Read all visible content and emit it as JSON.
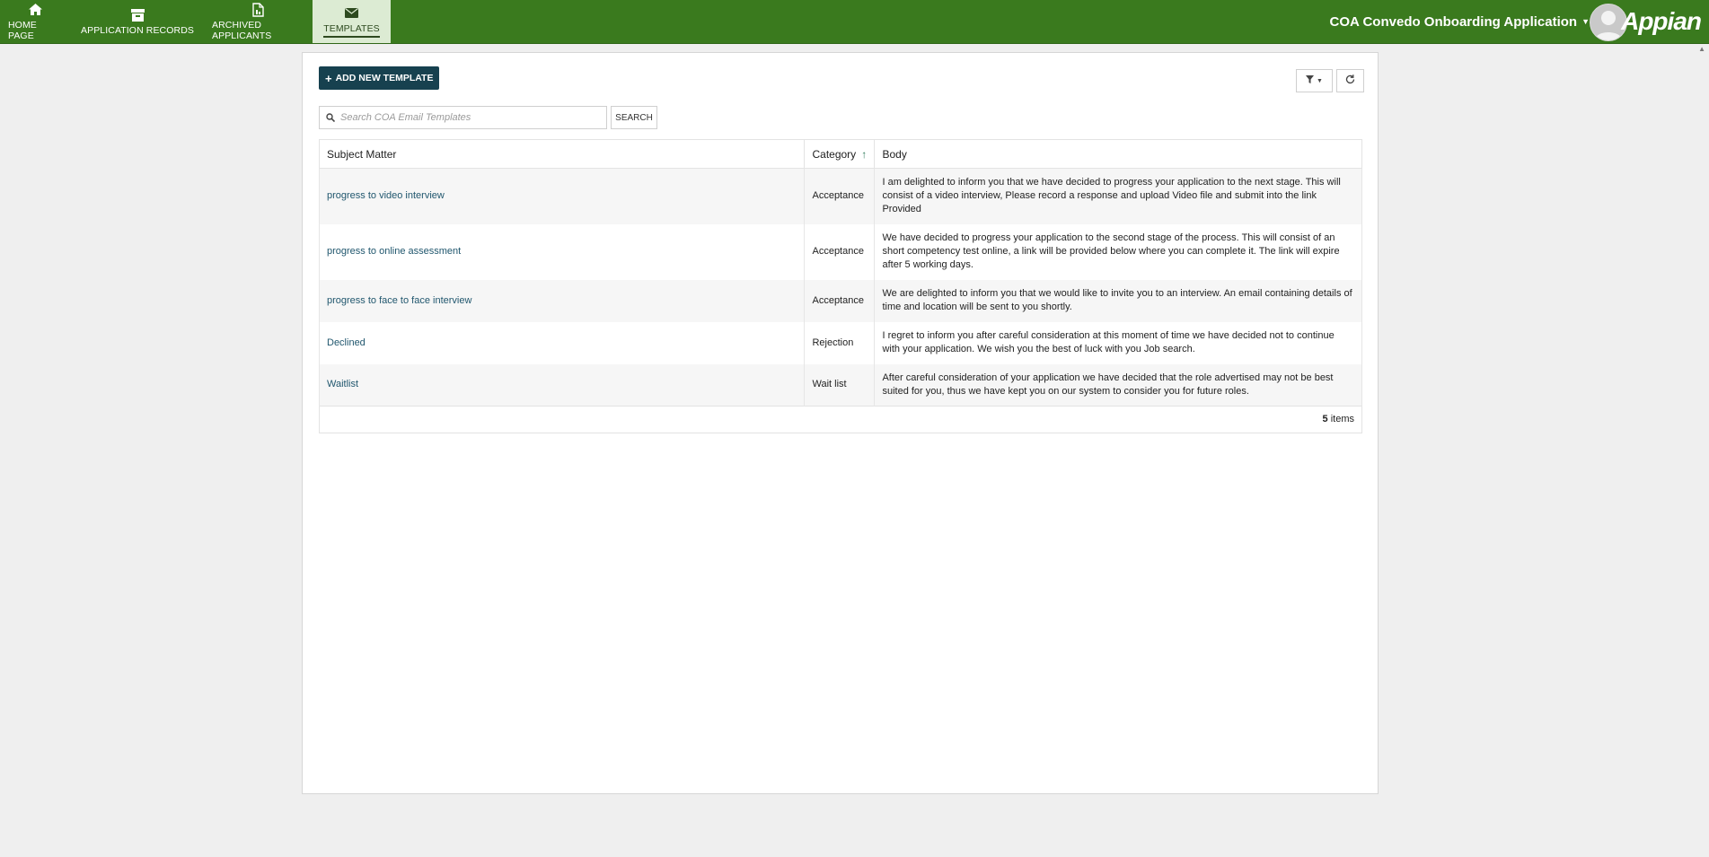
{
  "nav": {
    "items": [
      {
        "label": "HOME PAGE",
        "icon": "home-icon"
      },
      {
        "label": "APPLICATION RECORDS",
        "icon": "archive-box-icon"
      },
      {
        "label": "ARCHIVED APPLICANTS",
        "icon": "document-icon"
      },
      {
        "label": "TEMPLATES",
        "icon": "envelope-icon",
        "active": true
      }
    ]
  },
  "header": {
    "app_name": "COA Convedo Onboarding Application",
    "logo_text": "Appian"
  },
  "toolbar": {
    "add_label": "ADD NEW TEMPLATE",
    "search_placeholder": "Search COA Email Templates",
    "search_button": "SEARCH"
  },
  "grid": {
    "columns": [
      "Subject Matter",
      "Category",
      "Body"
    ],
    "sorted_column": "Category",
    "rows": [
      {
        "subject": "progress to video interview",
        "category": "Acceptance",
        "body": "I am delighted to inform you that we have decided to progress your application to the next stage. This will consist of a video interview, Please record a response and upload Video file and submit into the link Provided"
      },
      {
        "subject": "progress to online assessment",
        "category": "Acceptance",
        "body": "We have decided to progress your application to the second stage of the process. This will consist of an short competency test online, a link will be provided below where you can complete it. The link will expire after 5 working days."
      },
      {
        "subject": "progress to face to face interview",
        "category": "Acceptance",
        "body": "We are delighted to inform you that we would like to invite you to an interview. An email containing details of time and location will be sent to you shortly."
      },
      {
        "subject": "Declined",
        "category": "Rejection",
        "body": "I regret to inform you after careful consideration at this moment of time we have decided not to continue with your application. We wish you the best of luck with you Job search."
      },
      {
        "subject": "Waitlist",
        "category": "Wait list",
        "body": "After careful consideration of your application we have decided  that the role advertised may not be best suited for you, thus we have kept you on our system to consider you for future roles."
      }
    ],
    "count": "5",
    "count_suffix": "items"
  },
  "colors": {
    "topbar": "#3a7a1e",
    "active_tab": "#dcebd3",
    "primary_button": "#17414f",
    "link": "#21576e"
  }
}
